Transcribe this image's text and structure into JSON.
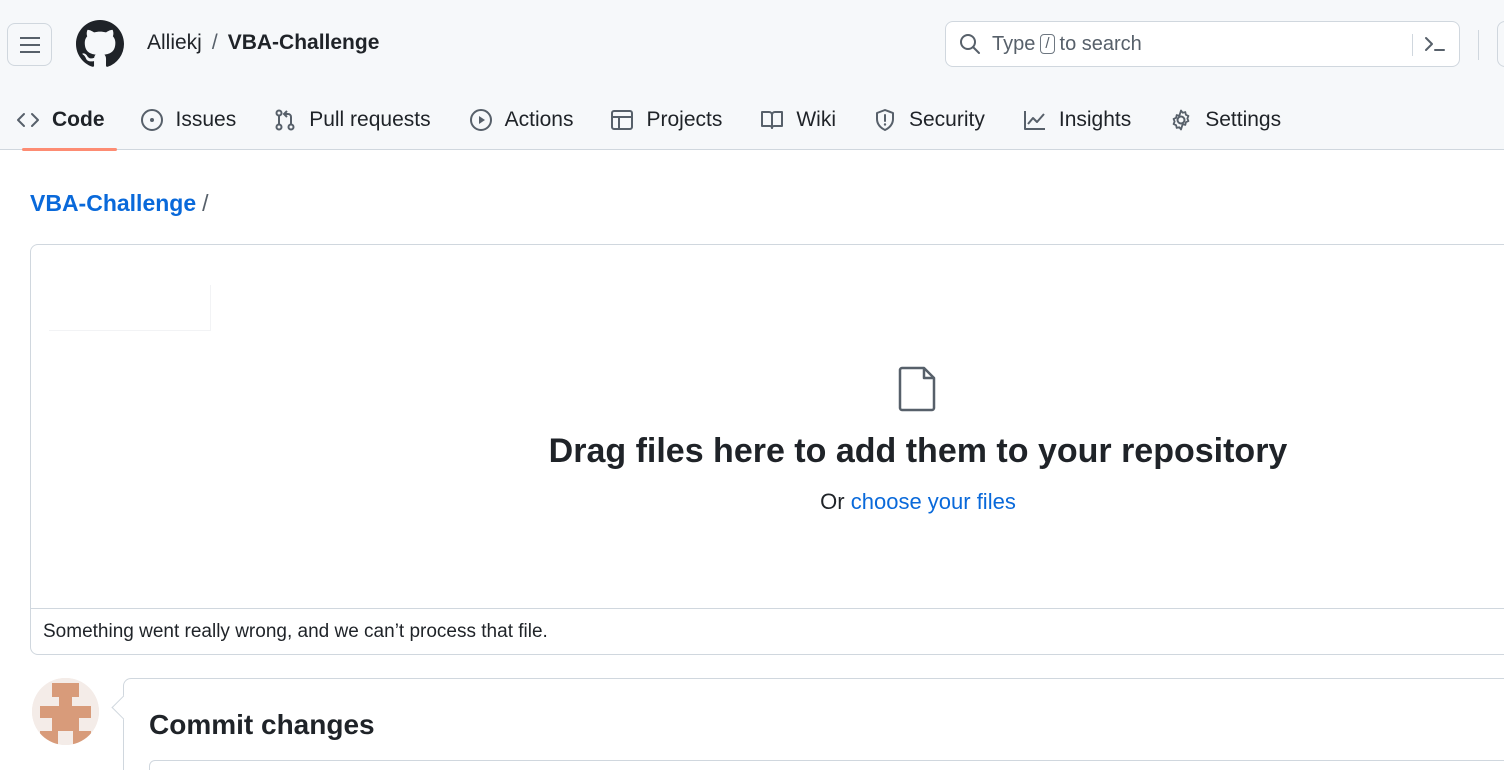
{
  "header": {
    "owner": "Alliekj",
    "separator": "/",
    "repo": "VBA-Challenge",
    "search": {
      "prefix": "Type",
      "key": "/",
      "suffix": "to search"
    },
    "icons": [
      "menu-icon",
      "github-logo-icon",
      "search-icon",
      "command-palette-icon"
    ]
  },
  "nav": {
    "tabs": [
      {
        "label": "Code",
        "icon": "code-icon",
        "active": true
      },
      {
        "label": "Issues",
        "icon": "issue-icon"
      },
      {
        "label": "Pull requests",
        "icon": "pull-request-icon"
      },
      {
        "label": "Actions",
        "icon": "play-icon"
      },
      {
        "label": "Projects",
        "icon": "table-icon"
      },
      {
        "label": "Wiki",
        "icon": "book-icon"
      },
      {
        "label": "Security",
        "icon": "shield-icon"
      },
      {
        "label": "Insights",
        "icon": "graph-icon"
      },
      {
        "label": "Settings",
        "icon": "gear-icon"
      }
    ]
  },
  "breadcrumb": {
    "repo_link": "VBA-Challenge",
    "slash": "/"
  },
  "dropzone": {
    "title": "Drag files here to add them to your repository",
    "or_text": "Or",
    "choose_link": "choose your files",
    "error": "Something went really wrong, and we can’t process that file."
  },
  "commit": {
    "title": "Commit changes"
  },
  "colors": {
    "link": "#0969da",
    "active_tab_underline": "#fd8c73",
    "border": "#d0d7de",
    "header_bg": "#f6f8fa"
  }
}
